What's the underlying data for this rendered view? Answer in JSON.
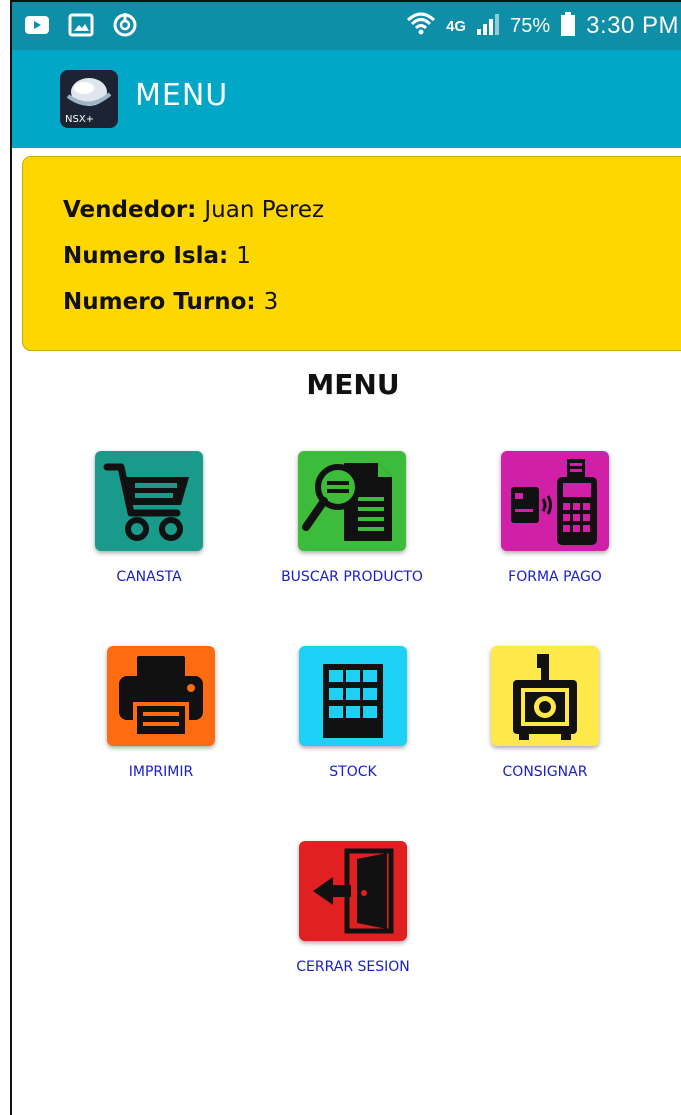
{
  "status_bar": {
    "battery": "75%",
    "time": "3:30 PM",
    "network": "4G",
    "icons": [
      "youtube-icon",
      "gallery-icon",
      "sync-icon",
      "wifi-icon",
      "network-4g-icon",
      "signal-icon",
      "battery-icon"
    ]
  },
  "app_bar": {
    "logo_text": "NSX+",
    "title": "MENU"
  },
  "info": {
    "vendor_label": "Vendedor:",
    "vendor_value": "Juan Perez",
    "island_label": "Numero Isla:",
    "island_value": "1",
    "shift_label": "Numero Turno:",
    "shift_value": "3"
  },
  "menu": {
    "heading": "MENU",
    "items": [
      {
        "label": "CANASTA",
        "icon": "shopping-cart-icon",
        "color": "#1a9a8a"
      },
      {
        "label": "BUSCAR PRODUCTO",
        "icon": "search-document-icon",
        "color": "#3dbb3a"
      },
      {
        "label": "FORMA PAGO",
        "icon": "card-terminal-icon",
        "color": "#d21fa7"
      },
      {
        "label": "IMPRIMIR",
        "icon": "printer-icon",
        "color": "#ff6b10"
      },
      {
        "label": "STOCK",
        "icon": "shelves-icon",
        "color": "#1fd0f5"
      },
      {
        "label": "CONSIGNAR",
        "icon": "safe-icon",
        "color": "#ffe94a"
      },
      {
        "label": "CERRAR SESION",
        "icon": "exit-door-icon",
        "color": "#e12121"
      }
    ]
  },
  "colors": {
    "status_bar": "#0f8ea7",
    "app_bar": "#00a7c6",
    "info_card": "#ffd700",
    "menu_label": "#1a20c8"
  }
}
